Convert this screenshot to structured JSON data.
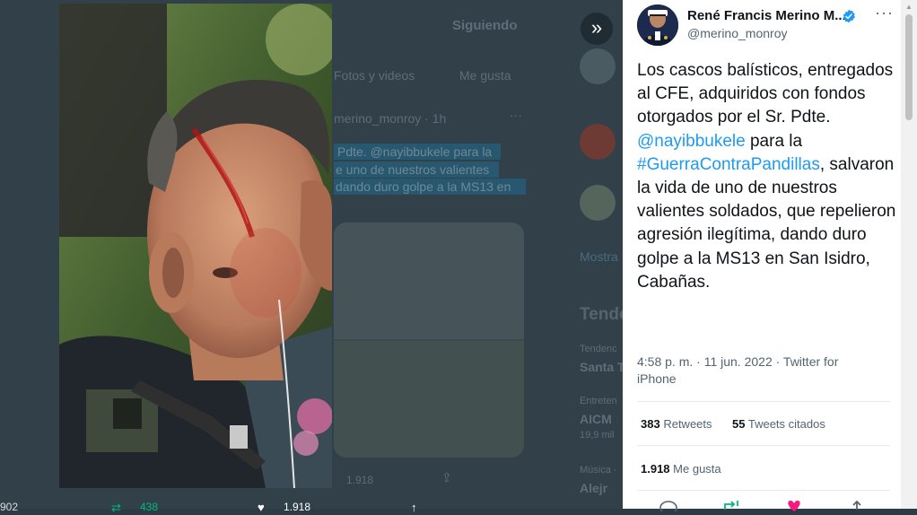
{
  "background": {
    "following_button": "Siguiendo",
    "tab_photos": "Fotos y videos",
    "tab_likes": "Me gusta",
    "handle_time": "merino_monroy · 1h",
    "tweet_fragment_1": "Pdte. @nayibbukele para la",
    "tweet_fragment_2": "e uno de nuestros valientes",
    "tweet_fragment_3": "dando duro golpe a la MS13 en",
    "side_label_1": "Mostra",
    "side_heading": "Tende",
    "trend_meta_1": "Tendenc",
    "trend_1": "Santa T",
    "trend_meta_2": "Entreten",
    "trend_2": "AICM",
    "trend_count_2": "19,9 mil",
    "trend_meta_3": "Música ·",
    "trend_3": "Alejr",
    "bottom_retweets": "438",
    "bottom_likes": "1.918",
    "bottom_left_count": "902",
    "card_likes": "1.918"
  },
  "expand_icon": "double-chevron-right-icon",
  "tweet": {
    "author_name": "René Francis Merino M...",
    "author_handle": "@merino_monroy",
    "text_parts": {
      "p1": "Los cascos balísticos, entregados al CFE, adquiridos con fondos otorgados por el Sr. Pdte. ",
      "mention": "@nayibbukele",
      "p2": " para la ",
      "hashtag": "#GuerraContraPandillas",
      "p3": ", salvaron la vida de uno de nuestros valientes soldados, que repelieron agresión ilegítima, dando duro golpe a la MS13 en San Isidro, Cabañas."
    },
    "timestamp": "4:58 p. m. · 11 jun. 2022 · ",
    "source": "Twitter for iPhone",
    "retweets_count": "383",
    "retweets_label": "Retweets",
    "quotes_count": "55",
    "quotes_label": "Tweets citados",
    "likes_count": "1.918",
    "likes_label": "Me gusta",
    "more_icon": "more-icon",
    "colors": {
      "link": "#1d9bf0",
      "verified": "#1d9bf0",
      "retweet": "#00ba7c",
      "like": "#f91880"
    }
  }
}
